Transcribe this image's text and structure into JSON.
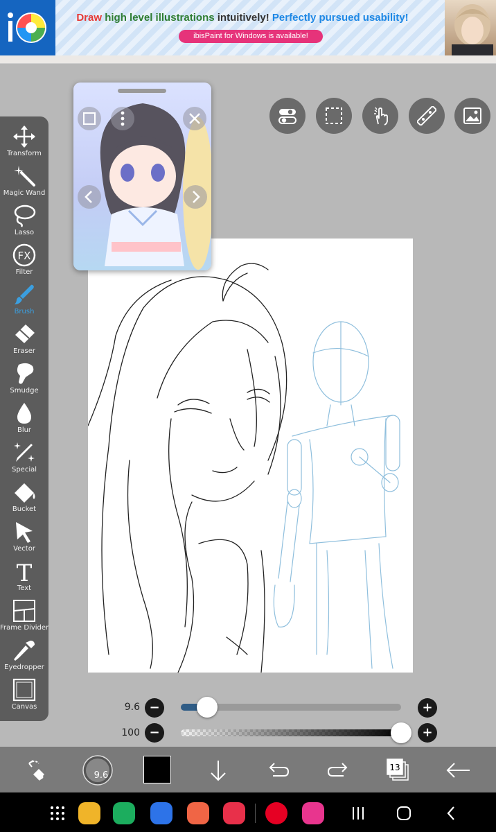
{
  "ad": {
    "headline_1": "Draw ",
    "headline_2": "high level illustrations",
    "headline_3": " intuitively! ",
    "headline_4": "Perfectly pursued usability!",
    "pill": "ibisPaint for Windows is available!",
    "logo_text": "iP"
  },
  "tools": [
    {
      "label": "Transform"
    },
    {
      "label": "Magic Wand"
    },
    {
      "label": "Lasso"
    },
    {
      "label": "Filter",
      "glyph": "FX"
    },
    {
      "label": "Brush"
    },
    {
      "label": "Eraser"
    },
    {
      "label": "Smudge"
    },
    {
      "label": "Blur"
    },
    {
      "label": "Special"
    },
    {
      "label": "Bucket"
    },
    {
      "label": "Vector"
    },
    {
      "label": "Text",
      "glyph": "T"
    },
    {
      "label": "Frame Divider"
    },
    {
      "label": "Eyedropper"
    },
    {
      "label": "Canvas"
    }
  ],
  "active_tool": "Brush",
  "sliders": {
    "brush_size_label": "9.6",
    "brush_size": 9.6,
    "brush_size_fraction": 0.12,
    "opacity_label": "100",
    "opacity_fraction": 1.0,
    "minus": "−",
    "plus": "+"
  },
  "bottom": {
    "brush_preview_label": "9.6",
    "layer_count": "13",
    "current_color": "#000000"
  },
  "colors": {
    "accent": "#3b9fe0",
    "toolbar": "#5c5c5c",
    "background": "#b8b8b8"
  }
}
